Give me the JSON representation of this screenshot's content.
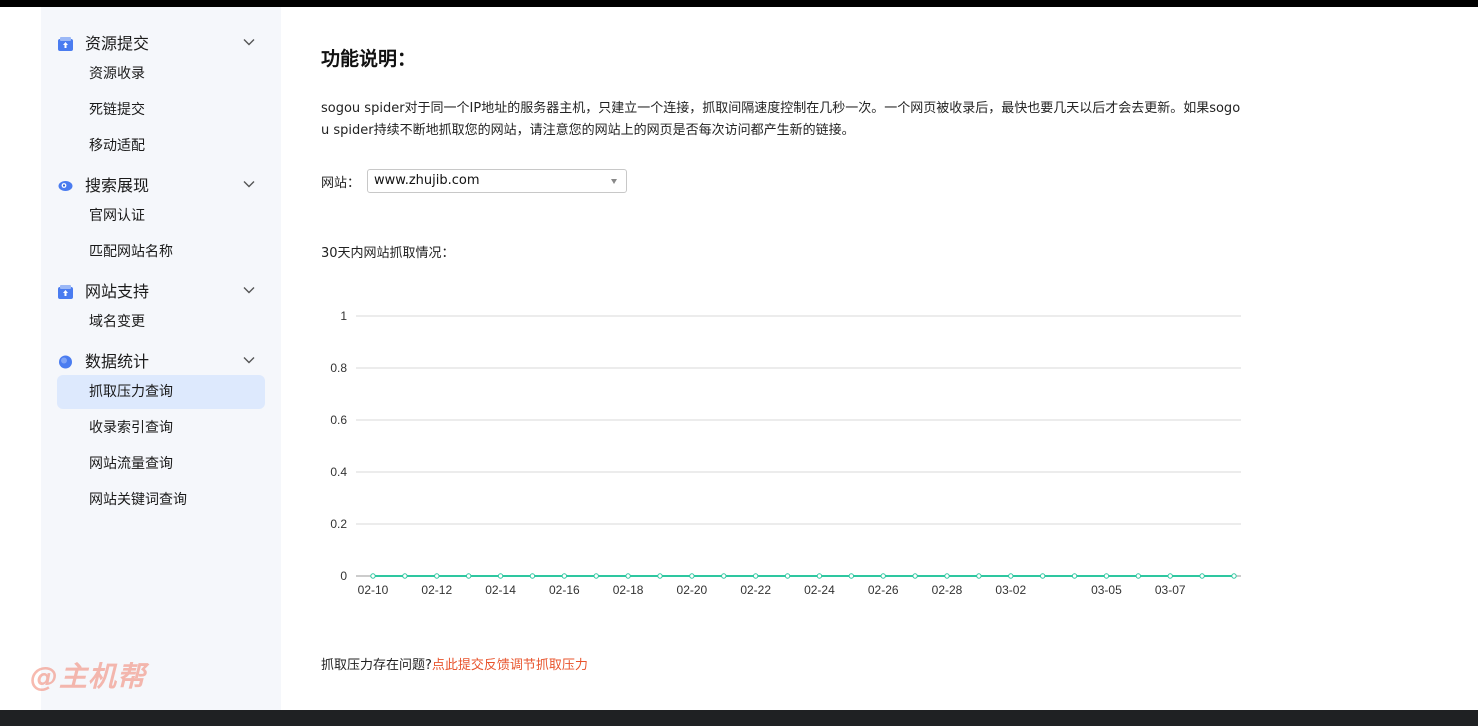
{
  "sidebar": {
    "groups": [
      {
        "label": "资源提交",
        "icon": "upload-box-icon",
        "items": [
          {
            "label": "资源收录"
          },
          {
            "label": "死链提交"
          },
          {
            "label": "移动适配"
          }
        ]
      },
      {
        "label": "搜索展现",
        "icon": "eye-icon",
        "items": [
          {
            "label": "官网认证"
          },
          {
            "label": "匹配网站名称"
          }
        ]
      },
      {
        "label": "网站支持",
        "icon": "support-box-icon",
        "items": [
          {
            "label": "域名变更"
          }
        ]
      },
      {
        "label": "数据统计",
        "icon": "stats-circle-icon",
        "items": [
          {
            "label": "抓取压力查询",
            "active": true
          },
          {
            "label": "收录索引查询"
          },
          {
            "label": "网站流量查询"
          },
          {
            "label": "网站关键词查询"
          }
        ]
      }
    ]
  },
  "main": {
    "title": "功能说明：",
    "description": "sogou spider对于同一个IP地址的服务器主机，只建立一个连接，抓取间隔速度控制在几秒一次。一个网页被收录后，最快也要几天以后才会去更新。如果sogou spider持续不断地抓取您的网站，请注意您的网站上的网页是否每次访问都产生新的链接。",
    "site_label": "网站：",
    "site_value": "www.zhujib.com",
    "chart_title": "30天内网站抓取情况：",
    "footer_prefix": "抓取压力存在问题?",
    "footer_link": "点此提交反馈调节抓取压力"
  },
  "watermark": "@主机帮",
  "colors": {
    "accent": "#4a7cf0",
    "active_bg": "#dde9fd",
    "line": "#2ec7a0",
    "link": "#e8542d"
  },
  "chart_data": {
    "type": "line",
    "title": "",
    "xlabel": "",
    "ylabel": "",
    "ylim": [
      0,
      1
    ],
    "y_ticks": [
      0,
      0.2,
      0.4,
      0.6,
      0.8,
      1
    ],
    "x": [
      "02-10",
      "02-11",
      "02-12",
      "02-13",
      "02-14",
      "02-15",
      "02-16",
      "02-17",
      "02-18",
      "02-19",
      "02-20",
      "02-21",
      "02-22",
      "02-23",
      "02-24",
      "02-25",
      "02-26",
      "02-27",
      "02-28",
      "03-01",
      "03-02",
      "03-03",
      "03-04",
      "03-05",
      "03-06",
      "03-07",
      "03-08",
      "03-09"
    ],
    "x_tick_labels": [
      "02-10",
      "02-12",
      "02-14",
      "02-16",
      "02-18",
      "02-20",
      "02-22",
      "02-24",
      "02-26",
      "02-28",
      "03-02",
      "03-05",
      "03-07"
    ],
    "series": [
      {
        "values": [
          0,
          0,
          0,
          0,
          0,
          0,
          0,
          0,
          0,
          0,
          0,
          0,
          0,
          0,
          0,
          0,
          0,
          0,
          0,
          0,
          0,
          0,
          0,
          0,
          0,
          0,
          0,
          0
        ]
      }
    ],
    "grid": true,
    "legend": "none"
  }
}
